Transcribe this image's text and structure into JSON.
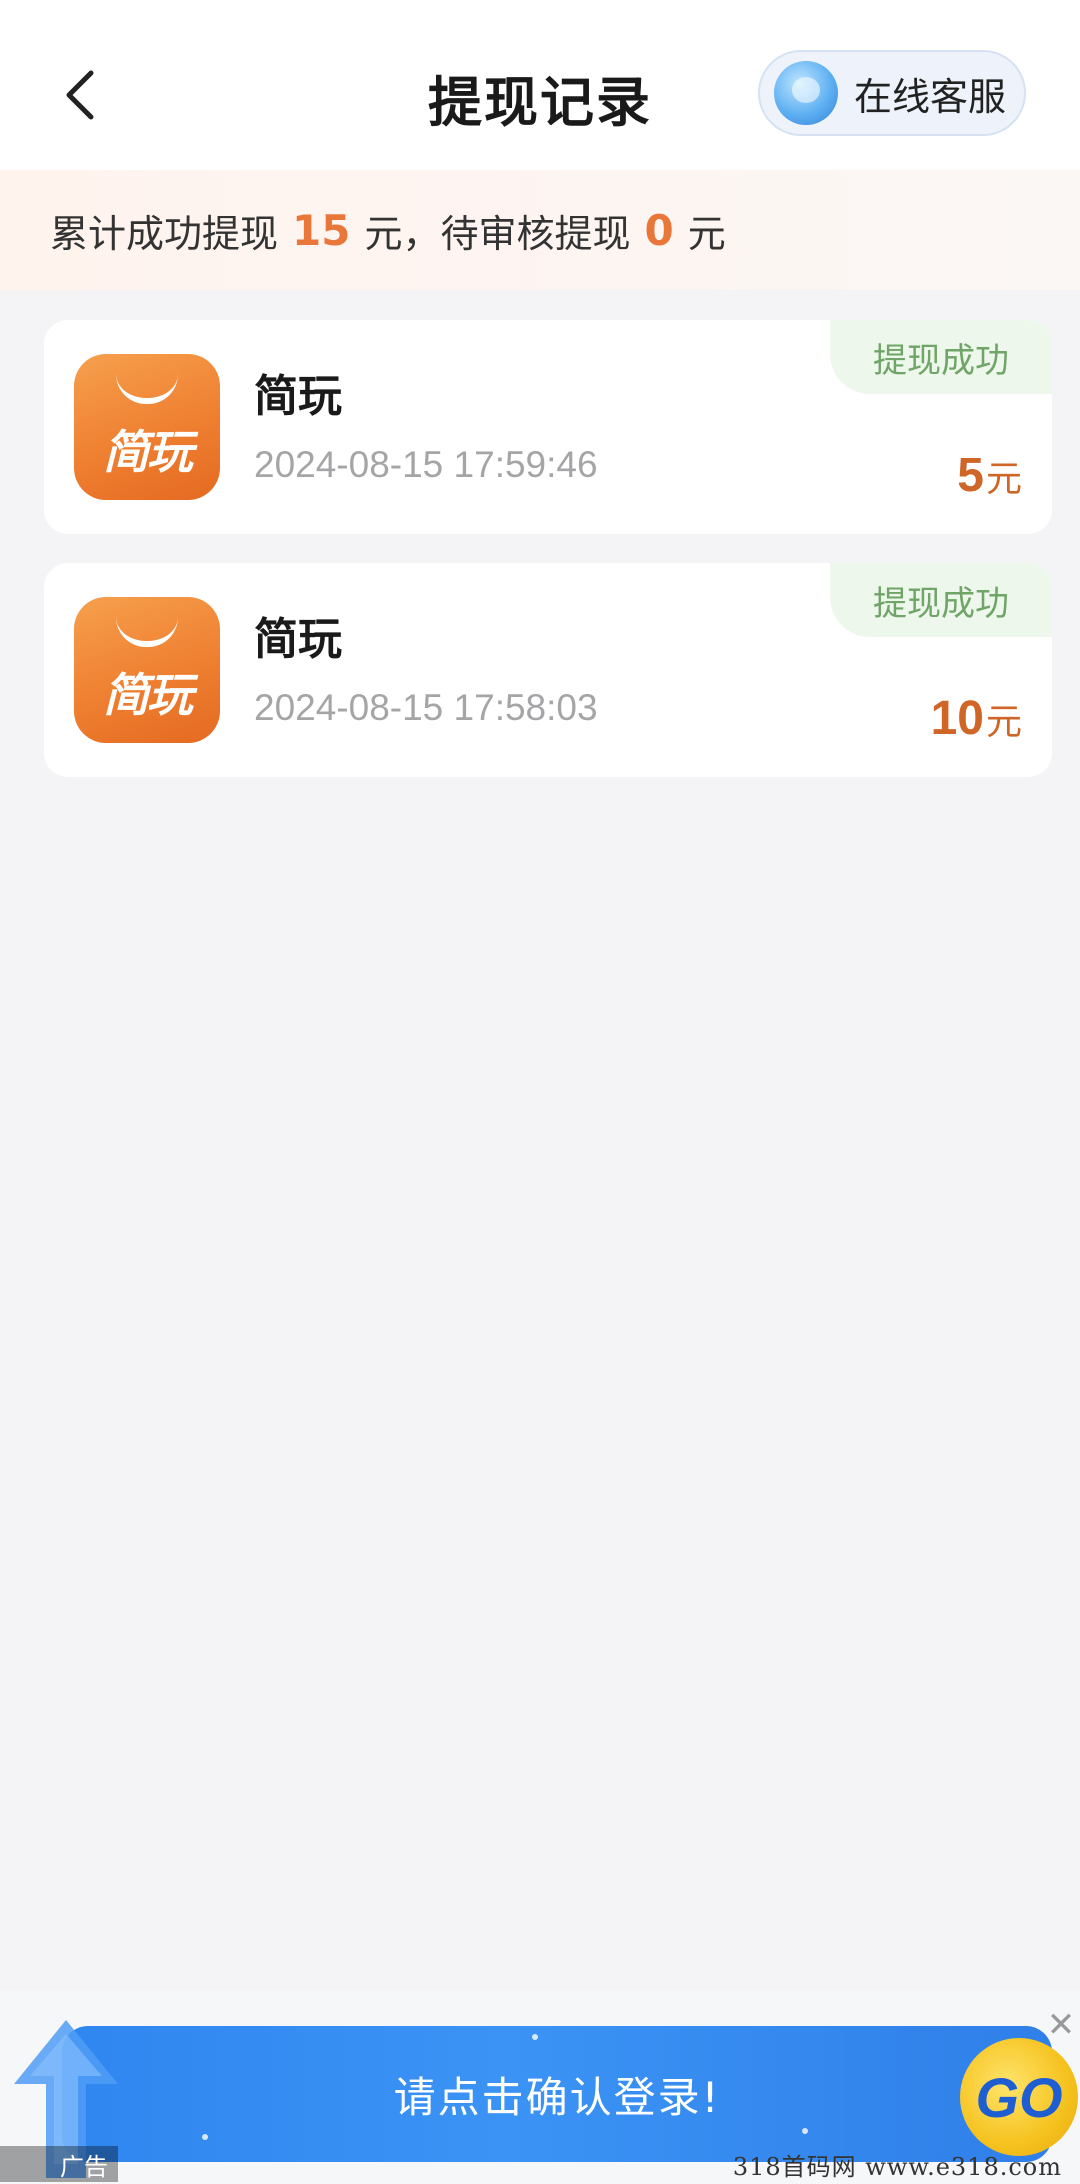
{
  "header": {
    "title": "提现记录",
    "service_label": "在线客服"
  },
  "summary": {
    "prefix": "累计成功提现",
    "success_amount": "15",
    "unit1": "元，待审核提现",
    "pending_amount": "0",
    "unit2": "元"
  },
  "records": [
    {
      "icon_text": "简玩",
      "name": "简玩",
      "time": "2024-08-15 17:59:46",
      "status": "提现成功",
      "amount": "5",
      "unit": "元"
    },
    {
      "icon_text": "简玩",
      "name": "简玩",
      "time": "2024-08-15 17:58:03",
      "status": "提现成功",
      "amount": "10",
      "unit": "元"
    }
  ],
  "ad": {
    "text": "请点击确认登录!",
    "go_label": "GO",
    "tag": "广告",
    "close": "✕"
  },
  "watermark": "318首码网 www.e318.com",
  "colors": {
    "accent": "#e9773a",
    "amount": "#cf6526",
    "status_text": "#6fa566",
    "ad_blue": "#2f86ef"
  }
}
